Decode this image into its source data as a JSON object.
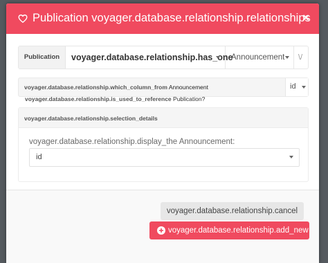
{
  "colors": {
    "accent": "#f04a5f",
    "backdrop": "#555a5f"
  },
  "header": {
    "title": "Publication voyager.database.relationship.relationships",
    "icon": "heart-icon",
    "close_symbol": "×"
  },
  "relationship": {
    "label": "Publication",
    "type_value": "voyager.database.relationship.has_one",
    "model_value": "Announcement",
    "extra_symbol": "\\/"
  },
  "column_from": {
    "prefix": "voyager.database.relationship.which_column_from",
    "model": "Announcement",
    "value": "id"
  },
  "used_to_reference": {
    "prefix": "voyager.database.relationship.is_used_to_reference",
    "model": "Publication?"
  },
  "details": {
    "heading": "voyager.database.relationship.selection_details",
    "display_label": "voyager.database.relationship.display_the Announcement:",
    "display_value": "id"
  },
  "footer": {
    "cancel_label": "voyager.database.relationship.cancel",
    "add_label": "voyager.database.relationship.add_new",
    "add_icon": "plus-circle-icon"
  }
}
